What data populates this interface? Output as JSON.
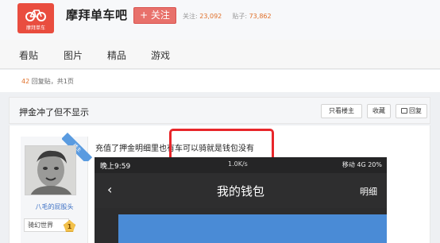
{
  "header": {
    "logo_text": "摩拜单车",
    "forum_name": "摩拜单车吧",
    "follow_label": "+ 关注",
    "follow_count_label": "关注:",
    "follow_count": "23,092",
    "post_count_label": "贴子:",
    "post_count": "73,862"
  },
  "nav": {
    "items": [
      "看贴",
      "图片",
      "精品",
      "游戏"
    ]
  },
  "reply": {
    "count": "42",
    "label": "回复贴，共1页"
  },
  "thread": {
    "title": "押金冲了但不显示",
    "buttons": {
      "op_only": "只看楼主",
      "favorite": "收藏",
      "reply": "回复"
    }
  },
  "post": {
    "badge": "楼主",
    "username": "八毛的屁股头",
    "level_name": "骑幻世界",
    "level_num": "1",
    "text": "充值了押金明细里也有车可以骑就是钱包没有"
  },
  "phone": {
    "time": "晚上9:59",
    "speed": "1.0K/s",
    "status_right": "移动 4G 20%",
    "title": "我的钱包",
    "back": "‹",
    "detail": "明细"
  },
  "colors": {
    "accent_red": "#e94d3f",
    "count_orange": "#e0702a",
    "link_blue": "#3b6fc4"
  }
}
